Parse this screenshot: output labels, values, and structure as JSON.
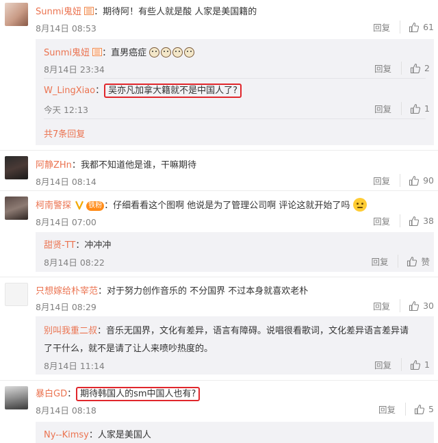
{
  "colors": {
    "username": "#eb7350",
    "meta": "#808080",
    "highlight_border": "#e0262b",
    "subbox_bg": "#f2f2f5"
  },
  "comments": [
    {
      "username": "Sunmi鬼妞",
      "text": "期待阿！有些人就是酸 人家是美国籍的",
      "date": "8月14日 08:53",
      "reply_label": "回复",
      "likes": "61",
      "replies": [
        {
          "username": "Sunmi鬼妞",
          "text": "直男癌症",
          "date": "8月14日 23:34",
          "reply_label": "回复",
          "likes": "2"
        },
        {
          "username": "W_LingXiao",
          "text": "吴亦凡加拿大籍就不是中国人了?",
          "date": "今天 12:13",
          "reply_label": "回复",
          "likes": "1"
        }
      ],
      "more_replies": "共7条回复"
    },
    {
      "username": "阿静ZHn",
      "text": "我都不知道他是谁，干嘛期待",
      "date": "8月14日 08:14",
      "reply_label": "回复",
      "likes": "90"
    },
    {
      "username": "柯南警探",
      "fan_badge": "铁粉",
      "text": "仔细看看这个图啊 他说是为了管理公司啊 评论这就开始了吗",
      "date": "8月14日 07:00",
      "reply_label": "回复",
      "likes": "38",
      "replies": [
        {
          "username": "甜贤-TT",
          "text": "冲冲冲",
          "date": "8月14日 08:22",
          "reply_label": "回复",
          "likes": "赞"
        }
      ]
    },
    {
      "username": "只想嫁给朴宰范",
      "text": "对于努力创作音乐的 不分国界 不过本身就喜欢老朴",
      "date": "8月14日 08:29",
      "reply_label": "回复",
      "likes": "30",
      "replies": [
        {
          "username": "别叫我重二叔",
          "text_line1": "音乐无国界，文化有差异，语言有障碍。说唱很看歌词，文化差异语言差异请",
          "text_line2": "了干什么，就不是请了让人来喷吵热度的。",
          "date": "8月14日 11:14",
          "reply_label": "回复",
          "likes": "1"
        }
      ]
    },
    {
      "username": "暴白GD",
      "text": "期待韩国人的sm中国人也有?",
      "date": "8月14日 08:18",
      "reply_label": "回复",
      "likes": "5",
      "replies": [
        {
          "username": "Ny--Kimsy",
          "text": "人家是美国人"
        }
      ]
    }
  ]
}
